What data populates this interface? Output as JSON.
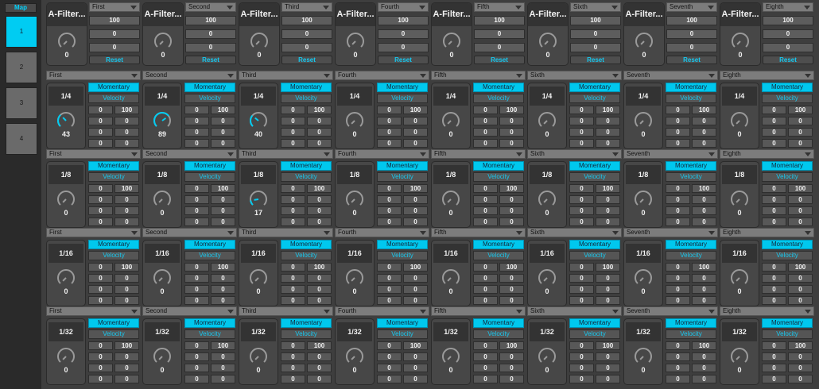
{
  "sidebar": {
    "map_label": "Map",
    "pages": [
      {
        "label": "1",
        "active": true
      },
      {
        "label": "2",
        "active": false
      },
      {
        "label": "3",
        "active": false
      },
      {
        "label": "4",
        "active": false
      }
    ]
  },
  "colors": {
    "accent": "#00ccf2",
    "background": "#3e3e3e",
    "panel": "#474747",
    "dropdown": "#7c7c7c"
  },
  "columns": [
    {
      "selector": "First"
    },
    {
      "selector": "Second"
    },
    {
      "selector": "Third"
    },
    {
      "selector": "Fourth"
    },
    {
      "selector": "Fifth"
    },
    {
      "selector": "Sixth"
    },
    {
      "selector": "Seventh"
    },
    {
      "selector": "Eighth"
    }
  ],
  "top_modules": [
    {
      "title": "A-Filter...",
      "selector": "First",
      "knob_value": "0",
      "fields": [
        "100",
        "0",
        "0"
      ],
      "reset_label": "Reset"
    },
    {
      "title": "A-Filter...",
      "selector": "Second",
      "knob_value": "0",
      "fields": [
        "100",
        "0",
        "0"
      ],
      "reset_label": "Reset"
    },
    {
      "title": "A-Filter...",
      "selector": "Third",
      "knob_value": "0",
      "fields": [
        "100",
        "0",
        "0"
      ],
      "reset_label": "Reset"
    },
    {
      "title": "A-Filter...",
      "selector": "Fourth",
      "knob_value": "0",
      "fields": [
        "100",
        "0",
        "0"
      ],
      "reset_label": "Reset"
    },
    {
      "title": "A-Filter...",
      "selector": "Fifth",
      "knob_value": "0",
      "fields": [
        "100",
        "0",
        "0"
      ],
      "reset_label": "Reset"
    },
    {
      "title": "A-Filter...",
      "selector": "Sixth",
      "knob_value": "0",
      "fields": [
        "100",
        "0",
        "0"
      ],
      "reset_label": "Reset"
    },
    {
      "title": "A-Filter...",
      "selector": "Seventh",
      "knob_value": "0",
      "fields": [
        "100",
        "0",
        "0"
      ],
      "reset_label": "Reset"
    },
    {
      "title": "A-Filter...",
      "selector": "Eighth",
      "knob_value": "0",
      "fields": [
        "100",
        "0",
        "0"
      ],
      "reset_label": "Reset"
    }
  ],
  "rows": [
    {
      "division": "1/4",
      "knob_values": [
        "43",
        "89",
        "40",
        "0",
        "0",
        "0",
        "0",
        "0"
      ]
    },
    {
      "division": "1/8",
      "knob_values": [
        "0",
        "0",
        "17",
        "0",
        "0",
        "0",
        "0",
        "0"
      ]
    },
    {
      "division": "1/16",
      "knob_values": [
        "0",
        "0",
        "0",
        "0",
        "0",
        "0",
        "0",
        "0"
      ]
    },
    {
      "division": "1/32",
      "knob_values": [
        "0",
        "0",
        "0",
        "0",
        "0",
        "0",
        "0",
        "0"
      ]
    }
  ],
  "pad": {
    "momentary_label": "Momentary",
    "velocity_label": "Velocity",
    "ranges": [
      [
        "0",
        "100"
      ],
      [
        "0",
        "0"
      ],
      [
        "0",
        "0"
      ],
      [
        "0",
        "0"
      ]
    ]
  }
}
